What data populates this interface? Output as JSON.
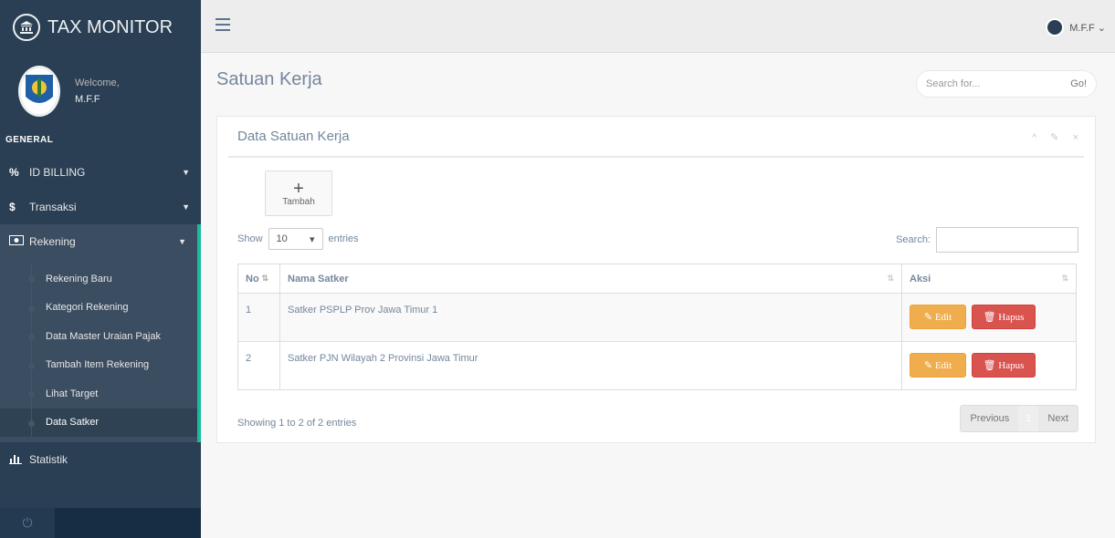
{
  "app": {
    "title": "TAX MONITOR",
    "logo_icon": "bank-icon"
  },
  "profile": {
    "welcome": "Welcome,",
    "name": "M.F.F"
  },
  "sidebar": {
    "section": "GENERAL",
    "items": [
      {
        "label": "ID BILLING",
        "icon": "percent-icon"
      },
      {
        "label": "Transaksi",
        "icon": "dollar-icon"
      },
      {
        "label": "Rekening",
        "icon": "money-icon"
      },
      {
        "label": "Statistik",
        "icon": "bar-chart-icon"
      }
    ],
    "subitems": [
      {
        "label": "Rekening Baru"
      },
      {
        "label": "Kategori Rekening"
      },
      {
        "label": "Data Master Uraian Pajak"
      },
      {
        "label": "Tambah Item Rekening"
      },
      {
        "label": "Lihat Target"
      },
      {
        "label": "Data Satker"
      }
    ]
  },
  "topbar": {
    "user": "M.F.F ⌄"
  },
  "page": {
    "title": "Satuan Kerja",
    "search_placeholder": "Search for...",
    "search_button": "Go!"
  },
  "panel": {
    "title": "Data Satuan Kerja",
    "tools": "^ ✎ ×",
    "add_label": "Tambah",
    "show_label": "Show",
    "entries_value": "10",
    "entries_label": "entries",
    "search_label": "Search:",
    "columns": [
      "No",
      "Nama Satker",
      "Aksi"
    ],
    "rows": [
      {
        "no": "1",
        "nama": "Satker PSPLP Prov Jawa Timur 1"
      },
      {
        "no": "2",
        "nama": "Satker PJN Wilayah 2 Provinsi Jawa Timur"
      }
    ],
    "edit_label": "Edit",
    "delete_label": "Hapus",
    "info": "Showing 1 to 2 of 2 entries",
    "prev_label": "Previous",
    "page_label": "1",
    "next_label": "Next"
  },
  "colors": {
    "sidebar": "#2A3F54",
    "accent": "#1ABB9C",
    "edit": "#F0AD4E",
    "delete": "#D9534F"
  }
}
